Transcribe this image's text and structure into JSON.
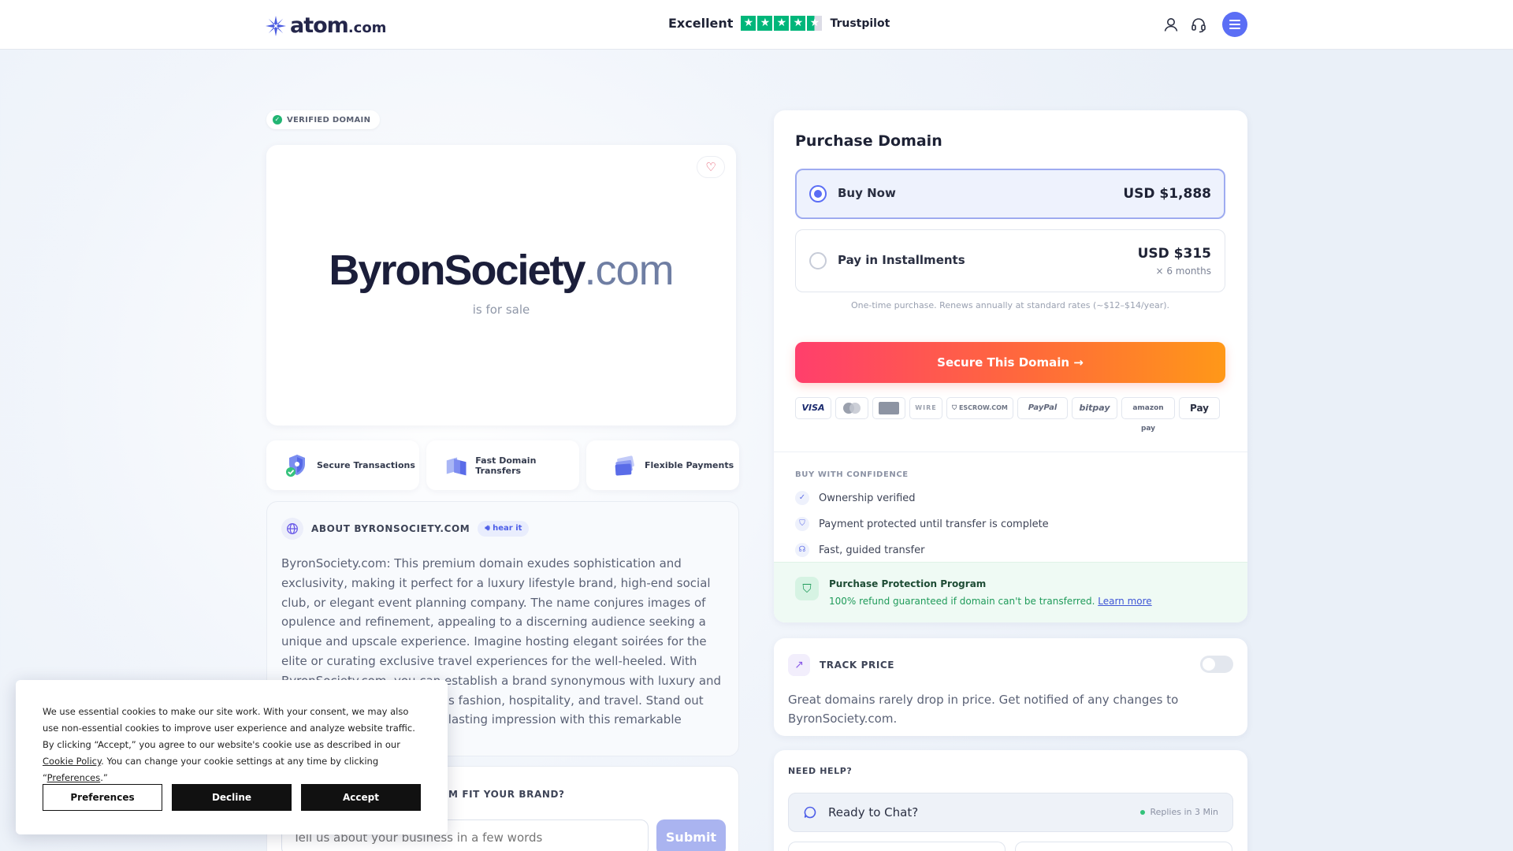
{
  "header": {
    "logo_word": "atom",
    "logo_tld": ".com",
    "trust_rating": "Excellent",
    "trust_brand": "Trustpilot",
    "stars": 4.5,
    "icons": [
      "user-icon",
      "headset-icon",
      "menu-icon"
    ]
  },
  "domain": {
    "badge": "VERIFIED DOMAIN",
    "name": "ByronSociety",
    "tld": ".com",
    "tagline": "is for sale"
  },
  "features": [
    {
      "label": "Secure Transactions",
      "icon": "shield-check-icon"
    },
    {
      "label": "Fast Domain Transfers",
      "icon": "transfer-cards-icon"
    },
    {
      "label": "Flexible Payments",
      "icon": "card-stack-icon"
    }
  ],
  "about": {
    "title": "ABOUT BYRONSOCIETY.COM",
    "hear_label": "hear it",
    "text": "ByronSociety.com: This premium domain exudes sophistication and exclusivity, making it perfect for a luxury lifestyle brand, high-end social club, or elegant event planning company. The name conjures images of opulence and refinement, appealing to a discerning audience seeking a unique and upscale experience. Imagine hosting elegant soirées for the elite or curating exclusive travel experiences for the well-heeled. With ByronSociety.com, you can establish a brand synonymous with luxury and prestige in industries such as fashion, hospitality, and travel. Stand out from the crowd and make a lasting impression with this remarkable domain."
  },
  "brand_fit": {
    "question": "M FIT YOUR BRAND?",
    "placeholder": "Tell us about your business in a few words",
    "submit": "Submit"
  },
  "purchase": {
    "title": "Purchase Domain",
    "options": [
      {
        "label": "Buy Now",
        "price": "USD $1,888",
        "sub": "",
        "selected": true
      },
      {
        "label": "Pay in Installments",
        "price": "USD $315",
        "sub": "× 6 months",
        "selected": false
      }
    ],
    "note": "One-time purchase. Renews annually at standard rates (~$12–$14/year).",
    "cta": "Secure This Domain",
    "payment_methods": [
      "VISA",
      "Mastercard",
      "AMEX",
      "WIRE",
      "ESCROW.COM",
      "PayPal",
      "bitpay",
      "amazon pay",
      "Pay"
    ],
    "confidence_title": "BUY WITH CONFIDENCE",
    "confidence_items": [
      "Ownership verified",
      "Payment protected until transfer is complete",
      "Fast, guided transfer"
    ],
    "protection_title": "Purchase Protection Program",
    "protection_text": "100% refund guaranteed if domain can't be transferred.",
    "protection_link": "Learn more"
  },
  "track": {
    "title": "TRACK PRICE",
    "enabled": false,
    "text": "Great domains rarely drop in price. Get notified of any changes to ByronSociety.com."
  },
  "help": {
    "title": "NEED HELP?",
    "chat_label": "Ready to Chat?",
    "replies": "Replies in 3 Min"
  },
  "cookie": {
    "text_before": "We use essential cookies to make our site work. With your consent, we may also use non-essential cookies to improve user experience and analyze website traffic. By clicking “Accept,” you agree to our website's cookie use as described in our ",
    "policy_link": "Cookie Policy",
    "text_middle": ". You can change your cookie settings at any time by clicking “",
    "pref_link": "Preferences",
    "text_after": ".”",
    "preferences": "Preferences",
    "decline": "Decline",
    "accept": "Accept"
  },
  "colors": {
    "accent": "#5b6ef5",
    "cta_start": "#ff3f6c",
    "cta_end": "#ff9818",
    "trust_green": "#00b67a",
    "protect_green": "#1f9b5a"
  }
}
